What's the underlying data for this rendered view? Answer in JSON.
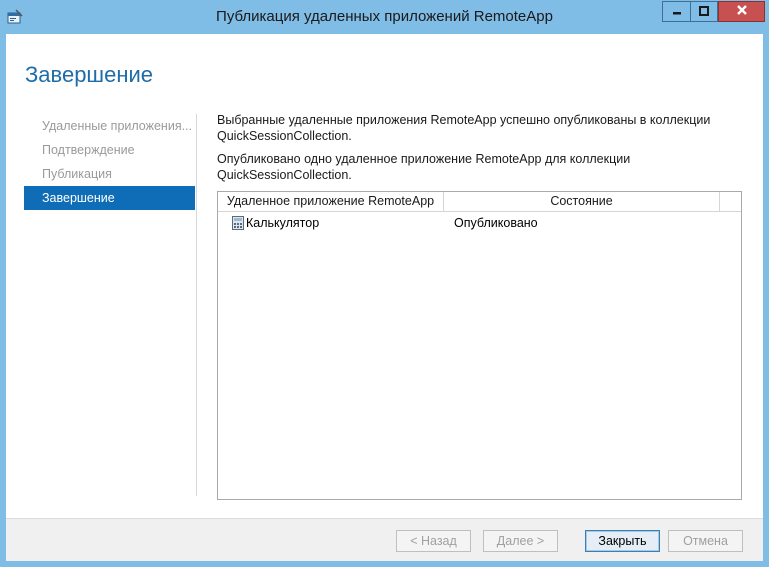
{
  "window": {
    "title": "Публикация удаленных приложений RemoteApp",
    "icon": "wizard-app-icon"
  },
  "page": {
    "title": "Завершение"
  },
  "steps": [
    {
      "label": "Удаленные приложения...",
      "active": false
    },
    {
      "label": "Подтверждение",
      "active": false
    },
    {
      "label": "Публикация",
      "active": false
    },
    {
      "label": "Завершение",
      "active": true
    }
  ],
  "content": {
    "paragraph1": "Выбранные удаленные приложения RemoteApp успешно опубликованы в коллекции QuickSessionCollection.",
    "paragraph2": "Опубликовано одно удаленное приложение RemoteApp для коллекции QuickSessionCollection."
  },
  "grid": {
    "columns": [
      "Удаленное приложение RemoteApp",
      "Состояние",
      ""
    ],
    "rows": [
      {
        "app": "Калькулятор",
        "status": "Опубликовано",
        "icon": "calculator-icon"
      }
    ]
  },
  "buttons": {
    "back": "< Назад",
    "next": "Далее >",
    "close": "Закрыть",
    "cancel": "Отмена"
  },
  "colors": {
    "frame": "#7fbce6",
    "accent": "#0e6db6",
    "title": "#1e6ca8",
    "close_button": "#c75050"
  }
}
